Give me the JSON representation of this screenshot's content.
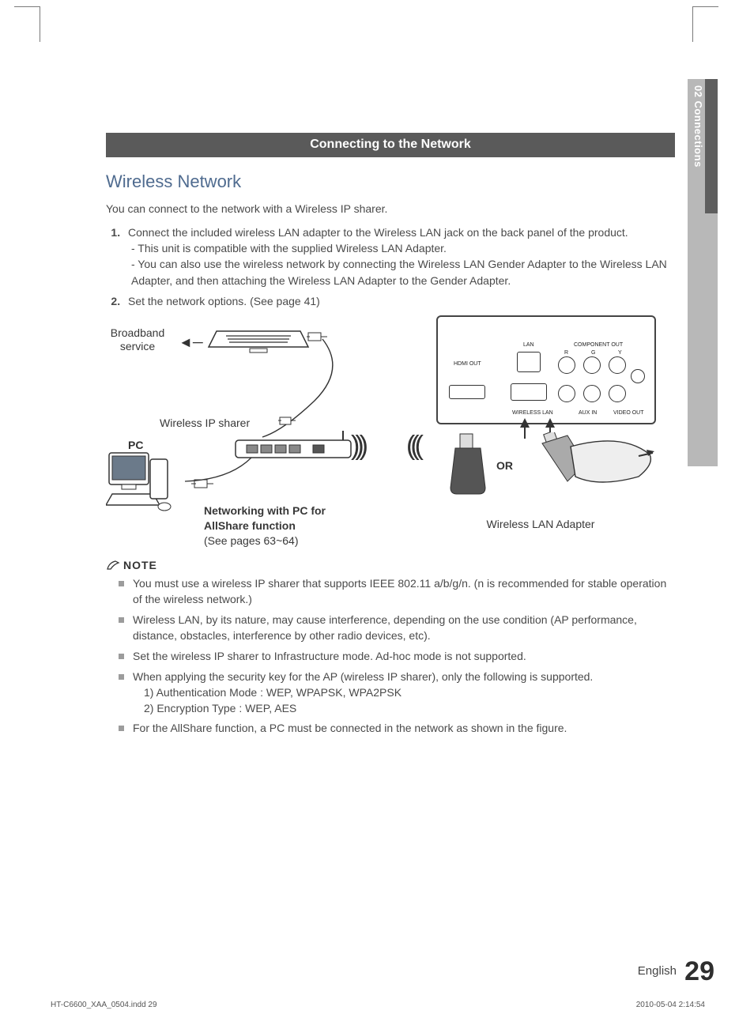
{
  "side_tab": "02  Connections",
  "banner": "Connecting to the Network",
  "section_title": "Wireless Network",
  "intro": "You can connect to the network with a Wireless IP sharer.",
  "steps": [
    {
      "text": "Connect the included wireless LAN adapter to the Wireless LAN jack on the back panel of the product.",
      "subs": [
        "- This unit is compatible with the supplied Wireless LAN Adapter.",
        "- You can also use the wireless network by connecting the Wireless LAN Gender Adapter to the Wireless LAN Adapter, and then attaching the Wireless LAN Adapter to the Gender Adapter."
      ]
    },
    {
      "text": "Set the network options. (See page 41)",
      "subs": []
    }
  ],
  "diagram": {
    "broadband": "Broadband service",
    "ip_sharer": "Wireless IP sharer",
    "pc": "PC",
    "networking_line1": "Networking with PC for",
    "networking_line2": "AllShare function",
    "networking_line3": "(See pages 63~64)",
    "or": "OR",
    "adapter": "Wireless LAN Adapter",
    "ports": {
      "hdmi": "HDMI OUT",
      "lan": "LAN",
      "component": "COMPONENT OUT",
      "wireless": "WIRELESS LAN",
      "aux": "AUX IN",
      "video": "VIDEO OUT",
      "r": "R",
      "g": "G",
      "y": "Y"
    }
  },
  "note_label": "NOTE",
  "notes": [
    "You must use a wireless IP sharer that supports IEEE 802.11 a/b/g/n. (n is recommended for stable operation of the wireless network.)",
    "Wireless LAN, by its nature, may cause interference, depending on the use condition (AP performance, distance, obstacles, interference by other radio devices, etc).",
    "Set the wireless IP sharer to Infrastructure mode. Ad-hoc mode is not supported.",
    "When applying the security key for the AP (wireless IP sharer), only the following is supported.",
    "For the AllShare function, a PC must be connected in the network as shown in the figure."
  ],
  "note4_sub": [
    "1)   Authentication Mode : WEP, WPAPSK, WPA2PSK",
    "2)   Encryption Type : WEP, AES"
  ],
  "footer": {
    "lang": "English",
    "page": "29",
    "file": "HT-C6600_XAA_0504.indd   29",
    "timestamp": "2010-05-04   2:14:54"
  }
}
